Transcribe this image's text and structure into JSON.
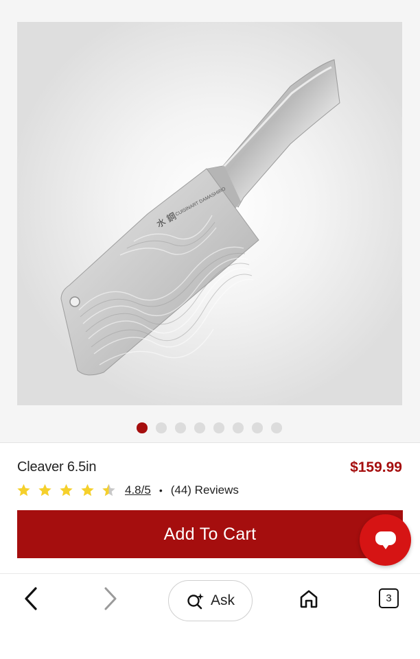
{
  "gallery": {
    "image_alt": "Cleaver knife product image",
    "dots_total": 8,
    "active_index": 0
  },
  "product": {
    "title": "Cleaver 6.5in",
    "price": "$159.99",
    "rating_value": 4.5,
    "rating_text": "4.8/5",
    "separator": "•",
    "reviews_text": "(44) Reviews"
  },
  "actions": {
    "add_to_cart": "Add To Cart"
  },
  "browser_nav": {
    "ask_label": "Ask",
    "tab_count": "3"
  },
  "colors": {
    "accent": "#a50e0e",
    "star": "#f5d02b",
    "chat": "#d61414"
  },
  "icons": [
    "back-arrow-icon",
    "forward-arrow-icon",
    "ask-sparkle-icon",
    "home-icon",
    "tabs-icon",
    "chat-icon",
    "star-icon"
  ]
}
